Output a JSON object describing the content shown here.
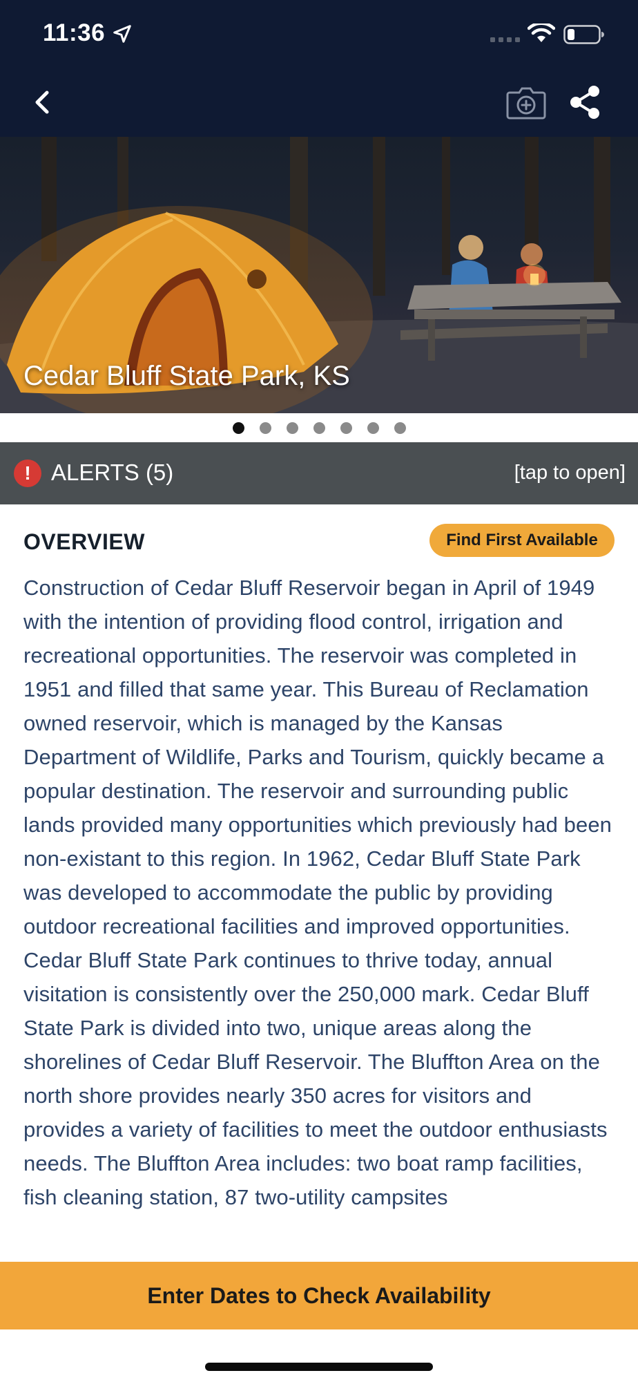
{
  "status_bar": {
    "time": "11:36",
    "icons": [
      "location-arrow-icon",
      "signal-icon",
      "wifi-icon",
      "battery-icon"
    ]
  },
  "nav": {
    "icons": [
      "chevron-left-icon",
      "camera-plus-icon",
      "share-icon"
    ]
  },
  "hero": {
    "title": "Cedar Bluff State Park, KS",
    "carousel_total": 7,
    "carousel_active": 1
  },
  "alerts": {
    "label": "ALERTS (5)",
    "hint": "[tap to open]",
    "icon": "exclamation-icon"
  },
  "overview": {
    "heading": "OVERVIEW",
    "find_button": "Find First Available",
    "body": "Construction of Cedar Bluff Reservoir began in April of 1949 with the intention of providing flood control, irrigation and recreational opportunities. The reservoir was completed in 1951 and filled that same year. This Bureau of Reclamation owned reservoir, which is managed by the Kansas Department of Wildlife, Parks and Tourism, quickly became a popular destination. The reservoir and surrounding public lands provided many opportunities which previously had been non-existant to this region. In 1962, Cedar Bluff State Park was developed to accommodate the public by providing outdoor recreational facilities and improved opportunities. Cedar Bluff State Park continues to thrive today, annual visitation is consistently over the 250,000 mark. Cedar Bluff State Park is divided into two, unique areas along the shorelines of Cedar Bluff Reservoir. The Bluffton Area on the north shore provides nearly 350 acres for visitors and provides a variety of facilities to meet the outdoor enthusiasts needs. The Bluffton Area includes: two boat ramp facilities, fish cleaning station, 87 two-utility campsites"
  },
  "cta": {
    "label": "Enter Dates to Check Availability"
  },
  "colors": {
    "header_bg": "#0f1a33",
    "accent": "#f2a63a",
    "alerts_bg": "#4a4f52",
    "alert_red": "#d63a34",
    "body_text": "#2d4468"
  }
}
